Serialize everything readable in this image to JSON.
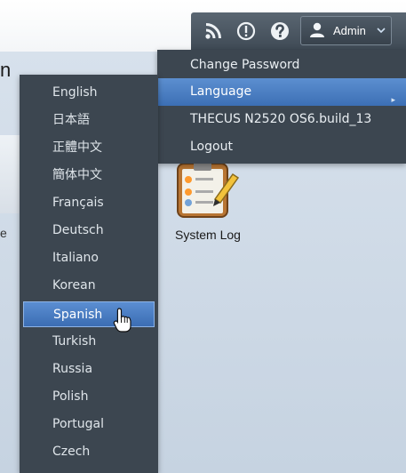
{
  "top_edge_text": "n",
  "desktop_edge_text": "e",
  "header": {
    "icons": [
      "rss-icon",
      "alert-icon",
      "help-icon"
    ],
    "admin_label": "Admin"
  },
  "admin_menu": {
    "items": [
      {
        "label": "Change Password"
      },
      {
        "label": "Language"
      },
      {
        "label": "THECUS N2520 OS6.build_13"
      },
      {
        "label": "Logout"
      }
    ]
  },
  "language_menu": {
    "items": [
      {
        "label": "English"
      },
      {
        "label": "日本語"
      },
      {
        "label": "正體中文"
      },
      {
        "label": "簡体中文"
      },
      {
        "label": "Français"
      },
      {
        "label": "Deutsch"
      },
      {
        "label": "Italiano"
      },
      {
        "label": "Korean"
      },
      {
        "label": "Spanish"
      },
      {
        "label": "Turkish"
      },
      {
        "label": "Russia"
      },
      {
        "label": "Polish"
      },
      {
        "label": "Portugal"
      },
      {
        "label": "Czech"
      }
    ]
  },
  "desktop": {
    "system_log_label": "System Log"
  },
  "colors": {
    "menu_bg": "#3c4650",
    "highlight": "#4a7fc2",
    "desktop_bg": "#c9d5e2"
  }
}
